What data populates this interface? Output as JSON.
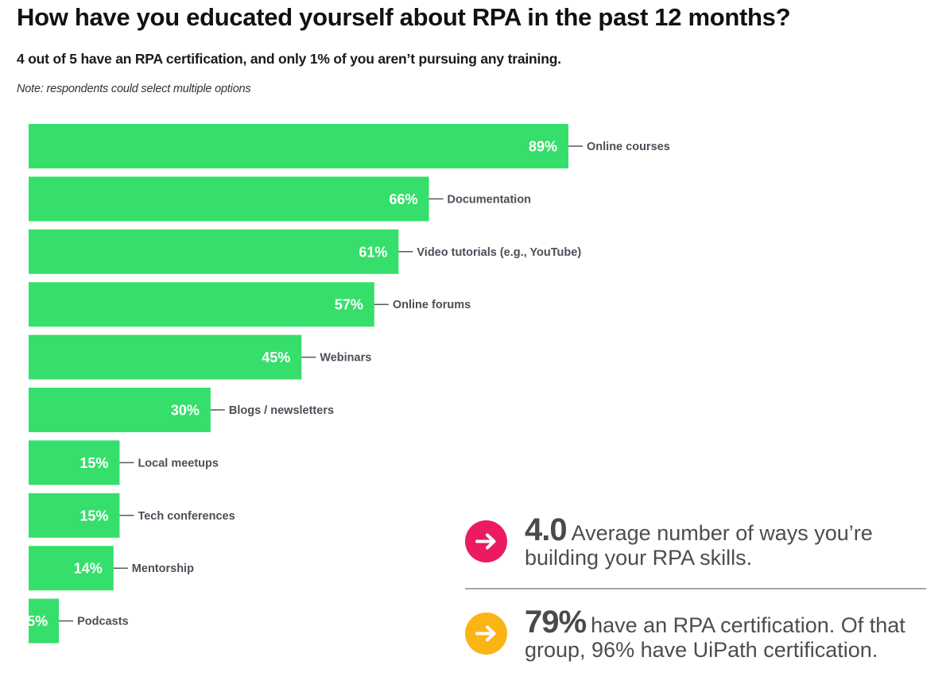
{
  "header": {
    "title": "How have you educated yourself about RPA in the past 12 months?",
    "subtitle": "4 out of 5 have an RPA certification, and only 1% of you aren’t pursuing any training.",
    "note": "Note: respondents could select multiple options"
  },
  "chart_data": {
    "type": "bar",
    "orientation": "horizontal",
    "title": "How have you educated yourself about RPA in the past 12 months?",
    "xlabel": "",
    "ylabel": "",
    "unit": "%",
    "xlim": [
      0,
      100
    ],
    "grid": false,
    "legend": "none",
    "categories": [
      "Online courses",
      "Documentation",
      "Video tutorials (e.g., YouTube)",
      "Online forums",
      "Webinars",
      "Blogs / newsletters",
      "Local meetups",
      "Tech conferences",
      "Mentorship",
      "Podcasts"
    ],
    "values": [
      89,
      66,
      61,
      57,
      45,
      30,
      15,
      15,
      14,
      5
    ],
    "data_labels": [
      "89%",
      "66%",
      "61%",
      "57%",
      "45%",
      "30%",
      "15%",
      "15%",
      "14%",
      "5%"
    ],
    "bar_color": "#36df6c"
  },
  "stats": [
    {
      "icon": "arrow-right-icon",
      "icon_color": "#ec1a63",
      "value": "4.0",
      "text": "Average number of ways you’re building your RPA skills."
    },
    {
      "icon": "arrow-right-icon",
      "icon_color": "#fbb416",
      "value": "79%",
      "text": "have an RPA certification. Of that group, 96% have UiPath certification."
    }
  ]
}
